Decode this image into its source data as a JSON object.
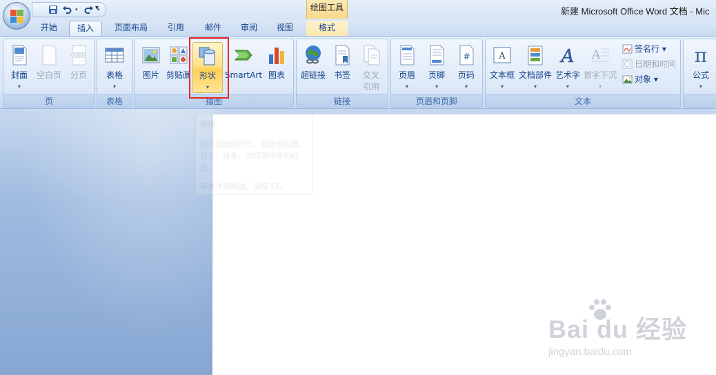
{
  "window": {
    "title": "新建 Microsoft Office Word 文档 - Mic"
  },
  "contextual": {
    "header": "绘图工具",
    "tab": "格式"
  },
  "tabs": [
    "开始",
    "插入",
    "页面布局",
    "引用",
    "邮件",
    "审阅",
    "视图"
  ],
  "active_tab": "插入",
  "qat": {
    "more": "▾"
  },
  "groups": {
    "page": {
      "label": "页",
      "buttons": [
        "封面",
        "空白页",
        "分页"
      ]
    },
    "table": {
      "label": "表格",
      "buttons": [
        "表格"
      ]
    },
    "illustration": {
      "label": "插图",
      "buttons": [
        "图片",
        "剪贴画",
        "形状",
        "SmartArt",
        "图表"
      ]
    },
    "links": {
      "label": "链接",
      "buttons": [
        "超链接",
        "书签",
        "交叉",
        "引用"
      ]
    },
    "header_footer": {
      "label": "页眉和页脚",
      "buttons": [
        "页眉",
        "页脚",
        "页码"
      ]
    },
    "text": {
      "label": "文本",
      "buttons": [
        "文本框",
        "文档部件",
        "艺术字",
        "首字下沉"
      ],
      "small_buttons": [
        "签名行 ▾",
        "日期和时间",
        "对象 ▾"
      ]
    },
    "symbols": {
      "buttons": [
        "公式"
      ]
    }
  },
  "tooltip": {
    "title": "形状",
    "body": "插入现成的形状，如矩形和圆、箭头、线条、流程图符号和标注。",
    "help": "有关详细帮助，请按 F1。"
  },
  "watermark": {
    "brand": "Bai  du 经验",
    "url": "jingyan.baidu.com"
  },
  "colors": {
    "accent": "#15428b",
    "highlight": "#e8262b",
    "hover": "#ffd057"
  }
}
